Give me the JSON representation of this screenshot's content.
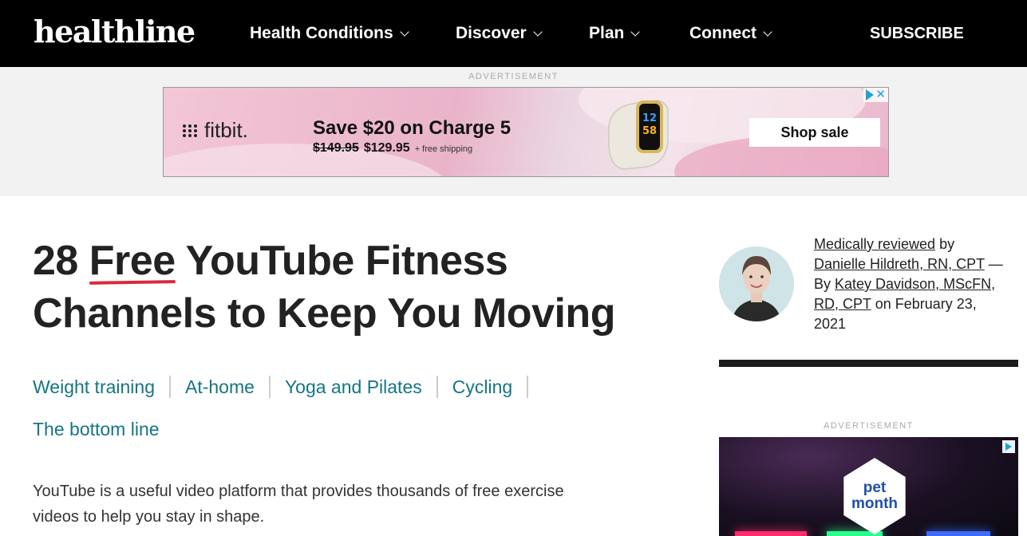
{
  "header": {
    "logo": "healthline",
    "nav": [
      {
        "label": "Health Conditions"
      },
      {
        "label": "Discover"
      },
      {
        "label": "Plan"
      },
      {
        "label": "Connect"
      }
    ],
    "subscribe": "SUBSCRIBE"
  },
  "top_ad": {
    "label": "ADVERTISEMENT",
    "brand": "fitbit.",
    "headline": "Save $20 on Charge 5",
    "old_price": "$149.95",
    "new_price": "$129.95",
    "shipping": "+ free shipping",
    "cta": "Shop sale",
    "watch_time_top": "12",
    "watch_time_bottom": "58"
  },
  "article": {
    "title_before": "28 ",
    "title_highlight": "Free",
    "title_after_line1": " YouTube Fitness",
    "title_line2": "Channels to Keep You Moving",
    "toc": [
      "Weight training",
      "At-home",
      "Yoga and Pilates",
      "Cycling"
    ],
    "toc_second_row": "The bottom line",
    "intro_line1": "YouTube is a useful video platform that provides thousands of free exercise",
    "intro_line2": "videos to help you stay in shape."
  },
  "sidebar": {
    "medically_reviewed": "Medically reviewed",
    "by": " by",
    "reviewer": "Danielle Hildreth, RN, CPT",
    "dash": " —",
    "by2": "By ",
    "author_part1": "Katey Davidson, MScFN,",
    "author_part2": "RD, CPT",
    "date_text": " on February 23,",
    "date_year": "2021",
    "ad_label": "ADVERTISEMENT",
    "ad_brand_top": "pet",
    "ad_brand_bottom": "month"
  },
  "colors": {
    "header_bg": "#000000",
    "link_teal": "#157585",
    "highlight_red": "#d92b3a",
    "adchoices_blue": "#1fa3d6"
  }
}
